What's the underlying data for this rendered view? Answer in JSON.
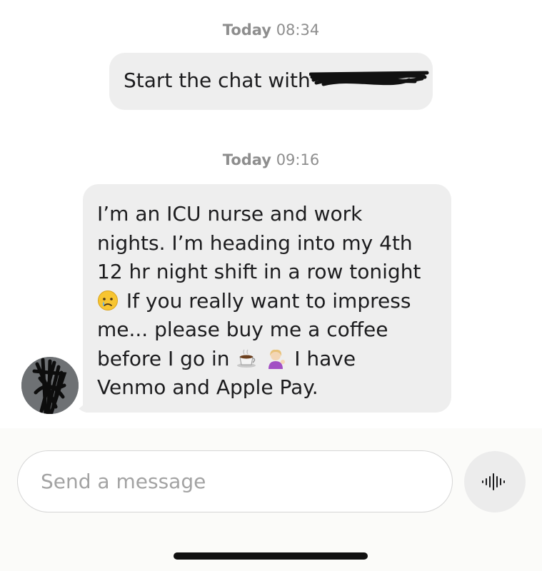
{
  "timestamps": [
    {
      "day": "Today",
      "time": "08:34"
    },
    {
      "day": "Today",
      "time": "09:16"
    }
  ],
  "sent_message": {
    "text": "Start the chat with"
  },
  "received_message": {
    "line1": "I’m an ICU nurse and work",
    "line2": "nights. I’m heading into my 4th",
    "line3": "12 hr night shift in a row tonight",
    "line4": "If you really want to impress",
    "line5": "me... please buy me a coffee",
    "line6a": "before I go in",
    "line6b": "I have",
    "line7": "Venmo and Apple Pay."
  },
  "emojis": [
    "crying-face-icon",
    "hot-beverage-icon",
    "person-tipping-hand-icon"
  ],
  "composer": {
    "placeholder": "Send a message"
  },
  "colors": {
    "bubble": "#eeeeee",
    "timestamp": "#8e8e8e",
    "placeholder": "#a3a3a3",
    "mic_bg": "#ececec"
  }
}
